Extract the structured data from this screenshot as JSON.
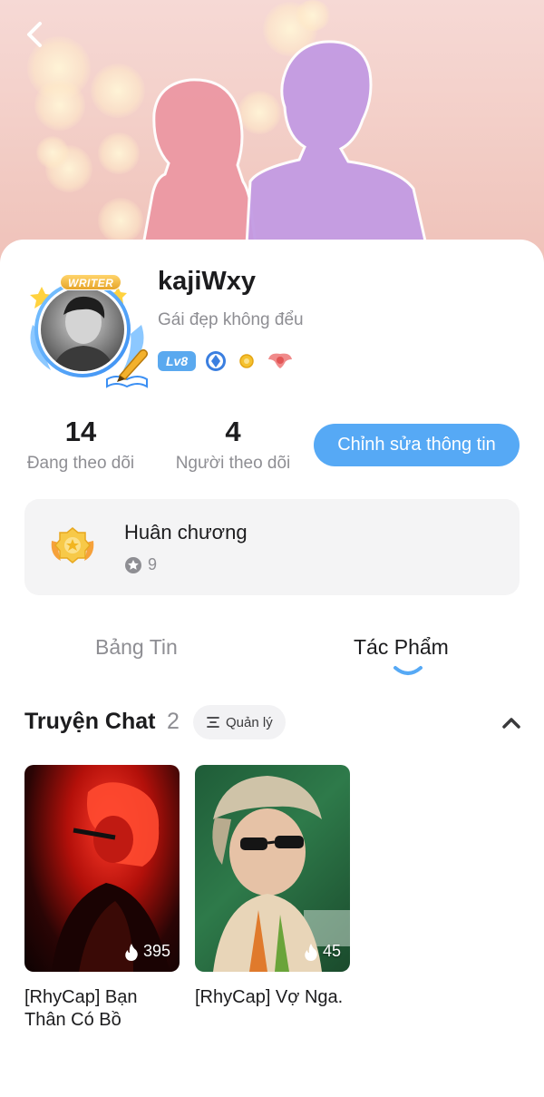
{
  "profile": {
    "username": "kajiWxy",
    "bio": "Gái đẹp không đểu",
    "writer_tag": "WRITER",
    "level": "Lv8"
  },
  "stats": {
    "following_count": "14",
    "following_label": "Đang theo dõi",
    "followers_count": "4",
    "followers_label": "Người theo dõi"
  },
  "actions": {
    "edit_label": "Chỉnh sửa thông tin"
  },
  "medals": {
    "title": "Huân chương",
    "count": "9"
  },
  "tabs": [
    {
      "label": "Bảng Tin",
      "active": false
    },
    {
      "label": "Tác Phẩm",
      "active": true
    }
  ],
  "section": {
    "title": "Truyện Chat",
    "count": "2",
    "manage_label": "Quản lý"
  },
  "stories": [
    {
      "title": "[RhyCap] Bạn Thân Có Bồ",
      "views": "395"
    },
    {
      "title": "[RhyCap] Vợ Nga.",
      "views": "45"
    }
  ],
  "colors": {
    "accent": "#56a9f5",
    "level_badge": "#5aa9ef",
    "muted_text": "#8e8e93"
  }
}
